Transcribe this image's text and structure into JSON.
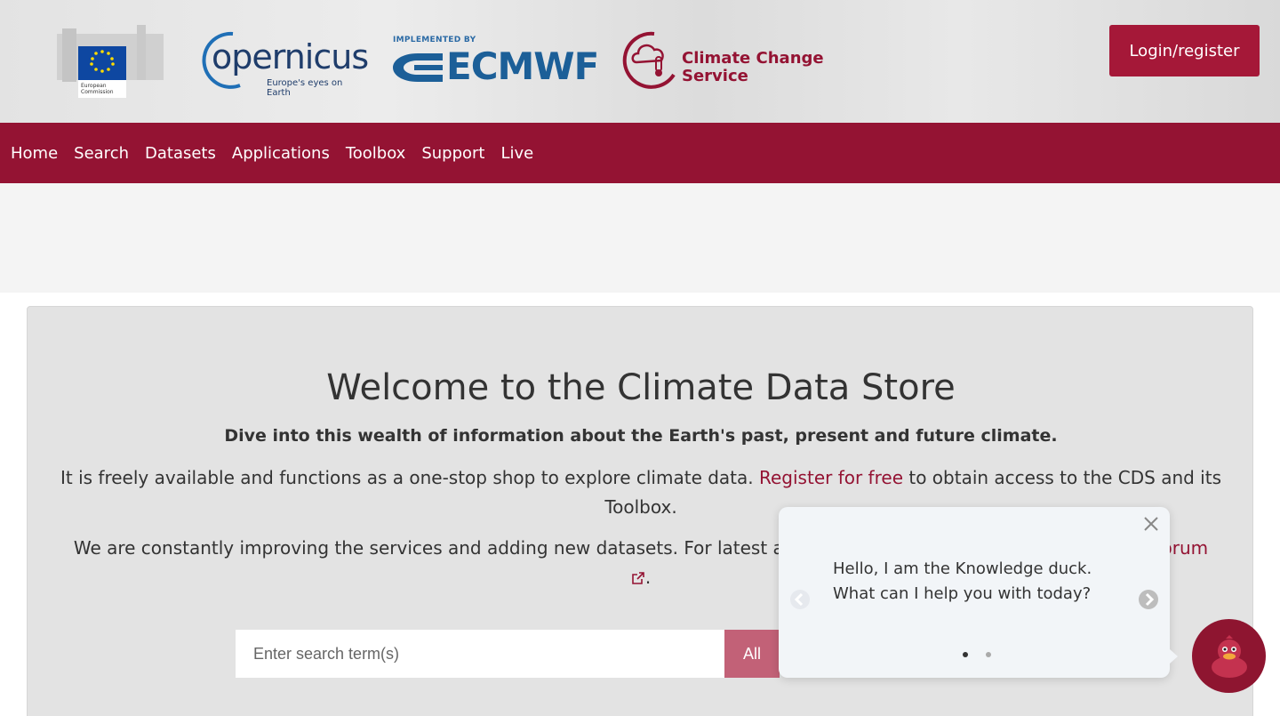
{
  "header": {
    "ec_logo_text": "European Commission",
    "copernicus_word": "opernicus",
    "copernicus_tagline": "Europe's eyes on Earth",
    "ecmwf_implemented": "IMPLEMENTED BY",
    "ecmwf_word": "ECMWF",
    "c3s_line1": "Climate Change",
    "c3s_line2": "Service",
    "login_label": "Login/register"
  },
  "nav": {
    "items": [
      "Home",
      "Search",
      "Datasets",
      "Applications",
      "Toolbox",
      "Support",
      "Live"
    ]
  },
  "welcome": {
    "title": "Welcome to the Climate Data Store",
    "subtitle": "Dive into this wealth of information about the Earth's past, present and future climate.",
    "para1_before": "It is freely available and functions as a one-stop shop to explore climate data. ",
    "para1_link": "Register for free",
    "para1_after": " to obtain access to the CDS and its Toolbox.",
    "para2_before": "We are constantly improving the services and adding new datasets. For latest an",
    "para2_link": "forum",
    "para2_after": "."
  },
  "search": {
    "placeholder": "Enter search term(s)",
    "scope_label": "All"
  },
  "chat": {
    "line1": "Hello, I am the Knowledge duck.",
    "line2": "What can I help you with today?",
    "page_index": 1,
    "page_count": 2
  },
  "colors": {
    "brand": "#941333",
    "button": "#a51838",
    "panel": "#e3e3e3"
  }
}
